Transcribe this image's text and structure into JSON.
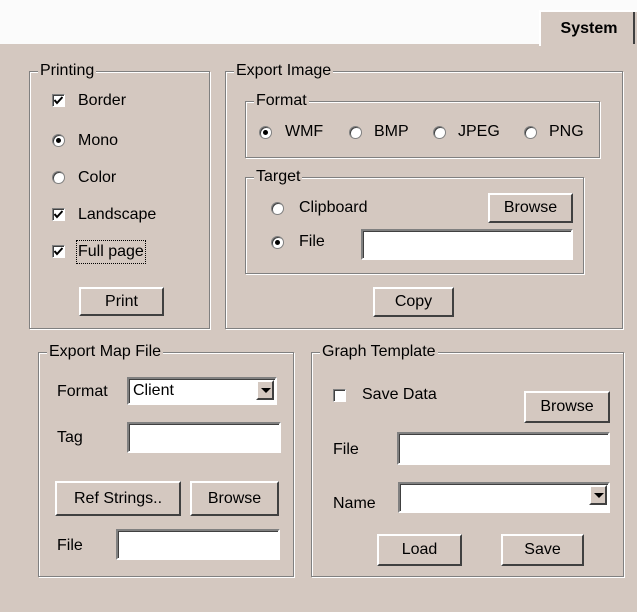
{
  "tab": {
    "label": "System"
  },
  "printing": {
    "legend": "Printing",
    "options": [
      {
        "label": "Border",
        "checked": true
      },
      {
        "label": "Mono",
        "selected": true
      },
      {
        "label": "Color",
        "selected": false
      },
      {
        "label": "Landscape",
        "checked": true
      },
      {
        "label": "Full page",
        "checked": true
      }
    ],
    "print_button": "Print"
  },
  "export_image": {
    "legend": "Export Image",
    "format": {
      "legend": "Format",
      "options": [
        {
          "label": "WMF",
          "selected": true
        },
        {
          "label": "BMP",
          "selected": false
        },
        {
          "label": "JPEG",
          "selected": false
        },
        {
          "label": "PNG",
          "selected": false
        }
      ]
    },
    "target": {
      "legend": "Target",
      "clipboard_label": "Clipboard",
      "file_label": "File",
      "file_value": "",
      "browse_button": "Browse"
    },
    "copy_button": "Copy"
  },
  "export_map_file": {
    "legend": "Export Map File",
    "format_label": "Format",
    "format_value": "Client",
    "tag_label": "Tag",
    "tag_value": "",
    "ref_strings_button": "Ref Strings..",
    "browse_button": "Browse",
    "file_label": "File",
    "file_value": ""
  },
  "graph_template": {
    "legend": "Graph Template",
    "save_data_label": "Save Data",
    "save_data_checked": false,
    "browse_button": "Browse",
    "file_label": "File",
    "file_value": "",
    "name_label": "Name",
    "name_value": "",
    "load_button": "Load",
    "save_button": "Save"
  }
}
